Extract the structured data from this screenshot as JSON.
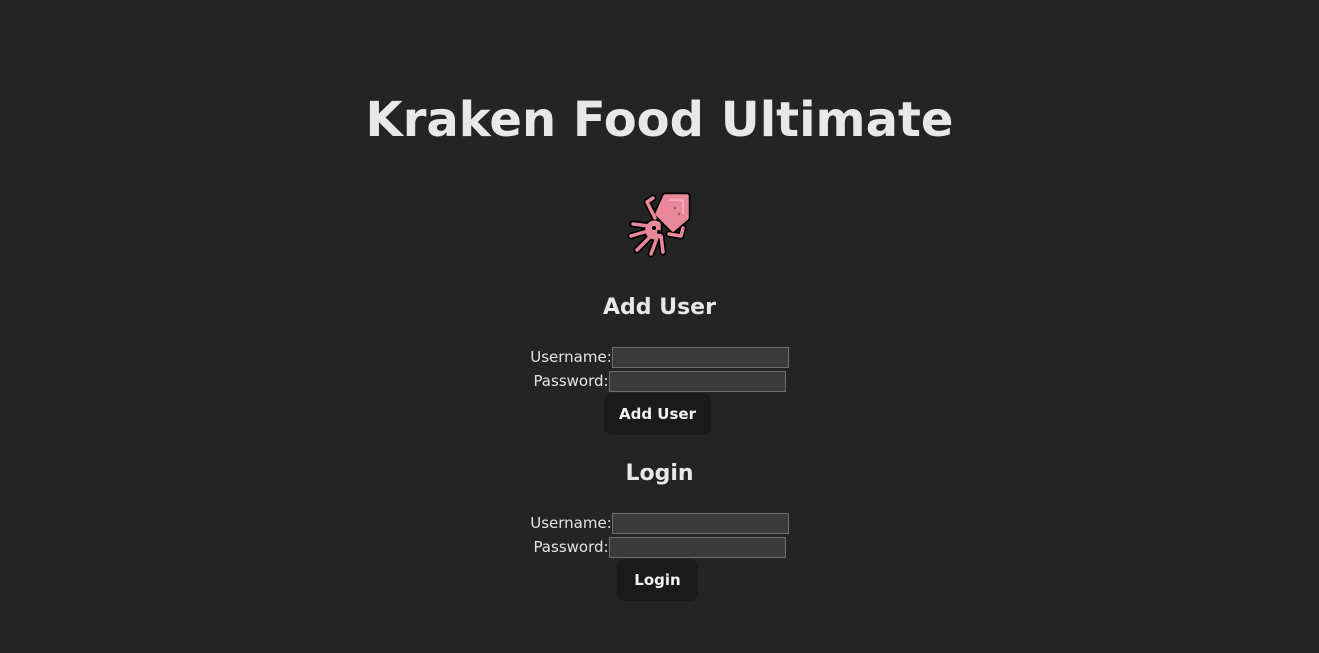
{
  "header": {
    "title": "Kraken Food Ultimate"
  },
  "logo": {
    "icon": "squid-icon",
    "color": "#e8889a"
  },
  "add_user": {
    "heading": "Add User",
    "username_label": "Username:",
    "username_value": "",
    "password_label": "Password:",
    "password_value": "",
    "button_label": "Add User"
  },
  "login": {
    "heading": "Login",
    "username_label": "Username:",
    "username_value": "",
    "password_label": "Password:",
    "password_value": "",
    "button_label": "Login"
  },
  "colors": {
    "background": "#242424",
    "text": "#e4e4e4",
    "button_bg": "#1a1a1a",
    "input_bg": "#3b3b3b"
  }
}
